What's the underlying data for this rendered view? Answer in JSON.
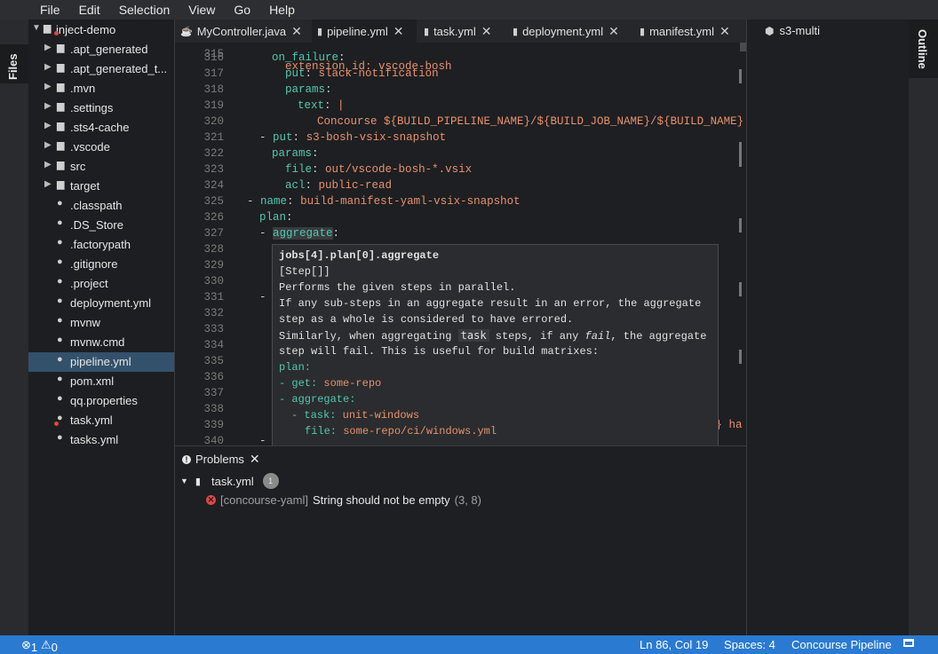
{
  "menu": [
    "File",
    "Edit",
    "Selection",
    "View",
    "Go",
    "Help"
  ],
  "left_tab": "Files",
  "right_tab": "Outline",
  "tree": {
    "root": "inject-demo",
    "items": [
      {
        "label": ".apt_generated",
        "type": "folder"
      },
      {
        "label": ".apt_generated_t...",
        "type": "folder"
      },
      {
        "label": ".mvn",
        "type": "folder"
      },
      {
        "label": ".settings",
        "type": "folder"
      },
      {
        "label": ".sts4-cache",
        "type": "folder"
      },
      {
        "label": ".vscode",
        "type": "folder"
      },
      {
        "label": "src",
        "type": "folder"
      },
      {
        "label": "target",
        "type": "folder"
      },
      {
        "label": ".classpath",
        "type": "file"
      },
      {
        "label": ".DS_Store",
        "type": "file"
      },
      {
        "label": ".factorypath",
        "type": "file"
      },
      {
        "label": ".gitignore",
        "type": "file"
      },
      {
        "label": ".project",
        "type": "file"
      },
      {
        "label": "deployment.yml",
        "type": "file"
      },
      {
        "label": "mvnw",
        "type": "file"
      },
      {
        "label": "mvnw.cmd",
        "type": "file"
      },
      {
        "label": "pipeline.yml",
        "type": "file"
      },
      {
        "label": "pom.xml",
        "type": "file"
      },
      {
        "label": "qq.properties",
        "type": "file"
      },
      {
        "label": "task.yml",
        "type": "file"
      },
      {
        "label": "tasks.yml",
        "type": "file"
      }
    ]
  },
  "tabs": [
    {
      "label": "MyController.java",
      "icon": "java-file-icon"
    },
    {
      "label": "pipeline.yml",
      "icon": "yaml-file-icon"
    },
    {
      "label": "task.yml",
      "icon": "yaml-file-icon"
    },
    {
      "label": "deployment.yml",
      "icon": "yaml-file-icon"
    },
    {
      "label": "manifest.yml",
      "icon": "yaml-file-icon"
    }
  ],
  "code": {
    "partial_top": "extension_id: vscode-bosh",
    "lines": [
      {
        "n": "316",
        "t": "on_failure:"
      },
      {
        "n": "317",
        "t": "put: slack-notification"
      },
      {
        "n": "318",
        "t": "params:"
      },
      {
        "n": "319",
        "t": "text: |"
      },
      {
        "n": "320",
        "t": "Concourse ${BUILD_PIPELINE_NAME}/${BUILD_JOB_NAME}/${BUILD_NAME} ha"
      },
      {
        "n": "321",
        "t": "- put: s3-bosh-vsix-snapshot"
      },
      {
        "n": "322",
        "t": "params:"
      },
      {
        "n": "323",
        "t": "file: out/vscode-bosh-*.vsix"
      },
      {
        "n": "324",
        "t": "acl: public-read"
      },
      {
        "n": "325",
        "t": "- name: build-manifest-yaml-vsix-snapshot"
      },
      {
        "n": "326",
        "t": "plan:"
      },
      {
        "n": "327",
        "t": "- aggregate:"
      },
      {
        "n": "328",
        "t": ""
      },
      {
        "n": "329",
        "t": ""
      },
      {
        "n": "330",
        "t": ""
      },
      {
        "n": "331",
        "t": "-"
      },
      {
        "n": "332",
        "t": ""
      },
      {
        "n": "333",
        "t": ""
      },
      {
        "n": "334",
        "t": ""
      },
      {
        "n": "335",
        "t": ""
      },
      {
        "n": "336",
        "t": ""
      },
      {
        "n": "337",
        "t": ""
      },
      {
        "n": "338",
        "t": ""
      },
      {
        "n": "339",
        "t": "E} ha"
      },
      {
        "n": "340",
        "t": "-"
      }
    ]
  },
  "hover": {
    "path": "jobs[4].plan[0].aggregate",
    "type": "[Step[]]",
    "desc1": "Performs the given steps in parallel.",
    "desc2": "If any sub-steps in an aggregate result in an error, the aggregate",
    "desc3": "step as a whole is considered to have errored.",
    "desc4a": "Similarly, when aggregating",
    "desc4code": "task",
    "desc4b": "steps, if any",
    "desc4em": "fail",
    "desc4c": ", the aggregate",
    "desc5": "step will fail. This is useful for build matrixes:",
    "ex1": "plan:",
    "ex2k": "- get:",
    "ex2v": "some-repo",
    "ex3": "- aggregate:",
    "ex4k": "- task:",
    "ex4v": "unit-windows",
    "ex5k": "file:",
    "ex5v": "some-repo/ci/windows.yml"
  },
  "problems": {
    "title": "Problems",
    "file": "task.yml",
    "count": "1",
    "source": "[concourse-yaml]",
    "message": "String should not be empty",
    "position": "(3, 8)"
  },
  "outline": {
    "item": "s3-multi"
  },
  "status": {
    "errors": "1",
    "warnings": "0",
    "position": "Ln 86, Col 19",
    "spaces": "Spaces: 4",
    "language": "Concourse Pipeline"
  }
}
